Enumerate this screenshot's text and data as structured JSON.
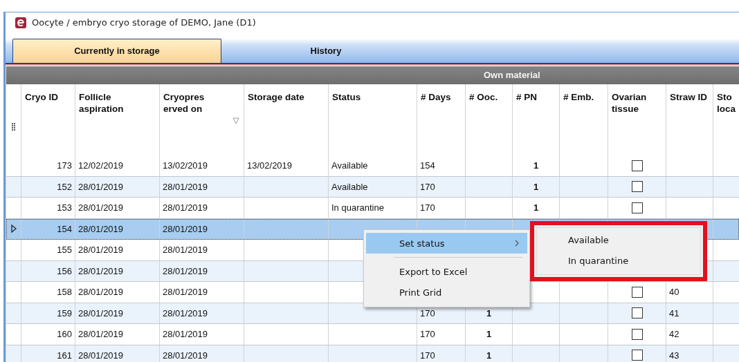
{
  "window": {
    "title": "Oocyte / embryo cryo storage of DEMO, Jane (D1)"
  },
  "tabs": [
    {
      "label": "Currently in storage",
      "selected": true
    },
    {
      "label": "History",
      "selected": false
    }
  ],
  "group_header": "Own material",
  "table": {
    "columns": [
      {
        "label": "Cryo ID",
        "kind": "right",
        "sorted": false
      },
      {
        "label": "Follicle aspiration",
        "kind": "text",
        "sorted": false
      },
      {
        "label": "Cryopres\nerved on",
        "kind": "text",
        "sorted": true
      },
      {
        "label": "Storage date",
        "kind": "text",
        "sorted": false
      },
      {
        "label": "Status",
        "kind": "text",
        "sorted": false
      },
      {
        "label": "# Days",
        "kind": "text",
        "sorted": false
      },
      {
        "label": "# Ooc.",
        "kind": "bold",
        "sorted": false
      },
      {
        "label": "# PN",
        "kind": "bold",
        "sorted": false
      },
      {
        "label": "# Emb.",
        "kind": "bold",
        "sorted": false
      },
      {
        "label": "Ovarian tissue",
        "kind": "checkbox",
        "sorted": false
      },
      {
        "label": "Straw ID",
        "kind": "text",
        "sorted": false
      },
      {
        "label": "Sto loca",
        "kind": "text",
        "sorted": false
      }
    ],
    "rows": [
      {
        "selected": false,
        "cells": [
          "173",
          "12/02/2019",
          "13/02/2019",
          "13/02/2019",
          "Available",
          "154",
          null,
          "1",
          null,
          {
            "checked": false
          },
          null,
          null
        ]
      },
      {
        "selected": false,
        "cells": [
          "152",
          "28/01/2019",
          "28/01/2019",
          null,
          "Available",
          "170",
          null,
          "1",
          null,
          {
            "checked": false
          },
          null,
          null
        ]
      },
      {
        "selected": false,
        "cells": [
          "153",
          "28/01/2019",
          "28/01/2019",
          null,
          "In quarantine",
          "170",
          null,
          "1",
          null,
          {
            "checked": false
          },
          null,
          null
        ]
      },
      {
        "selected": true,
        "cells": [
          "154",
          "28/01/2019",
          "28/01/2019",
          null,
          null,
          null,
          null,
          null,
          null,
          null,
          null,
          null
        ]
      },
      {
        "selected": false,
        "cells": [
          "155",
          "28/01/2019",
          "28/01/2019",
          null,
          null,
          null,
          null,
          null,
          null,
          null,
          null,
          null
        ]
      },
      {
        "selected": false,
        "cells": [
          "156",
          "28/01/2019",
          "28/01/2019",
          null,
          null,
          null,
          null,
          null,
          null,
          null,
          null,
          null
        ]
      },
      {
        "selected": false,
        "cells": [
          "158",
          "28/01/2019",
          "28/01/2019",
          null,
          null,
          null,
          null,
          null,
          null,
          {
            "checked": false
          },
          "40",
          null
        ]
      },
      {
        "selected": false,
        "cells": [
          "159",
          "28/01/2019",
          "28/01/2019",
          null,
          null,
          "170",
          "1",
          null,
          null,
          {
            "checked": false
          },
          "41",
          null
        ]
      },
      {
        "selected": false,
        "cells": [
          "160",
          "28/01/2019",
          "28/01/2019",
          null,
          null,
          "170",
          "1",
          null,
          null,
          {
            "checked": false
          },
          "42",
          null
        ]
      },
      {
        "selected": false,
        "cells": [
          "161",
          "28/01/2019",
          "28/01/2019",
          null,
          null,
          "170",
          "1",
          null,
          null,
          {
            "checked": false
          },
          "43",
          null
        ]
      }
    ]
  },
  "context_menu": {
    "items": [
      {
        "label": "Set status",
        "kind": "submenu",
        "selected": true
      },
      {
        "label": "Export to Excel",
        "kind": "item",
        "selected": false
      },
      {
        "label": "Print Grid",
        "kind": "item",
        "selected": false
      }
    ]
  },
  "submenu": {
    "items": [
      {
        "label": "Available"
      },
      {
        "label": "In quarantine"
      }
    ]
  }
}
